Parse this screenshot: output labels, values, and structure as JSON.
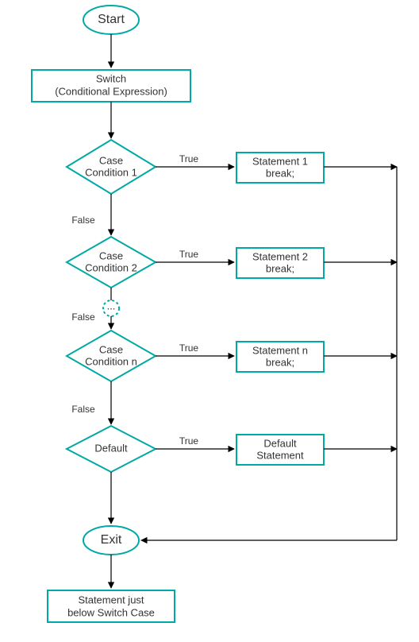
{
  "colors": {
    "accent": "#00a9a5",
    "text": "#333333",
    "edge": "#000000"
  },
  "nodes": {
    "start": {
      "label": "Start"
    },
    "switch": {
      "line1": "Switch",
      "line2": "(Conditional Expression)"
    },
    "case1": {
      "line1": "Case",
      "line2": "Condition 1"
    },
    "case2": {
      "line1": "Case",
      "line2": "Condition 2"
    },
    "casen": {
      "line1": "Case",
      "line2": "Condition n"
    },
    "default": {
      "line1": "Default"
    },
    "stmt1": {
      "line1": "Statement 1",
      "line2": "break;"
    },
    "stmt2": {
      "line1": "Statement 2",
      "line2": "break;"
    },
    "stmtn": {
      "line1": "Statement n",
      "line2": "break;"
    },
    "stmtdef": {
      "line1": "Default",
      "line2": "Statement"
    },
    "exit": {
      "label": "Exit"
    },
    "below": {
      "line1": "Statement just",
      "line2": "below Switch Case"
    },
    "ellipsis": {
      "label": "..."
    }
  },
  "edge_labels": {
    "true": "True",
    "false": "False"
  },
  "chart_data": {
    "type": "flowchart",
    "title": "Switch Case Flowchart",
    "nodes": [
      {
        "id": "start",
        "shape": "terminator",
        "label": "Start"
      },
      {
        "id": "switch",
        "shape": "process",
        "label": "Switch (Conditional Expression)"
      },
      {
        "id": "case1",
        "shape": "decision",
        "label": "Case Condition 1"
      },
      {
        "id": "stmt1",
        "shape": "process",
        "label": "Statement 1 break;"
      },
      {
        "id": "case2",
        "shape": "decision",
        "label": "Case Condition 2"
      },
      {
        "id": "stmt2",
        "shape": "process",
        "label": "Statement 2 break;"
      },
      {
        "id": "ellipsis",
        "shape": "connector",
        "label": "..."
      },
      {
        "id": "casen",
        "shape": "decision",
        "label": "Case Condition n"
      },
      {
        "id": "stmtn",
        "shape": "process",
        "label": "Statement n break;"
      },
      {
        "id": "default",
        "shape": "decision",
        "label": "Default"
      },
      {
        "id": "stmtdef",
        "shape": "process",
        "label": "Default Statement"
      },
      {
        "id": "exit",
        "shape": "terminator",
        "label": "Exit"
      },
      {
        "id": "below",
        "shape": "process",
        "label": "Statement just below Switch Case"
      }
    ],
    "edges": [
      {
        "from": "start",
        "to": "switch",
        "label": ""
      },
      {
        "from": "switch",
        "to": "case1",
        "label": ""
      },
      {
        "from": "case1",
        "to": "stmt1",
        "label": "True"
      },
      {
        "from": "case1",
        "to": "case2",
        "label": "False"
      },
      {
        "from": "case2",
        "to": "stmt2",
        "label": "True"
      },
      {
        "from": "case2",
        "to": "ellipsis",
        "label": "False"
      },
      {
        "from": "ellipsis",
        "to": "casen",
        "label": ""
      },
      {
        "from": "casen",
        "to": "stmtn",
        "label": "True"
      },
      {
        "from": "casen",
        "to": "default",
        "label": "False"
      },
      {
        "from": "default",
        "to": "stmtdef",
        "label": "True"
      },
      {
        "from": "default",
        "to": "exit",
        "label": "False"
      },
      {
        "from": "stmt1",
        "to": "exit",
        "label": ""
      },
      {
        "from": "stmt2",
        "to": "exit",
        "label": ""
      },
      {
        "from": "stmtn",
        "to": "exit",
        "label": ""
      },
      {
        "from": "stmtdef",
        "to": "exit",
        "label": ""
      },
      {
        "from": "exit",
        "to": "below",
        "label": ""
      }
    ]
  }
}
